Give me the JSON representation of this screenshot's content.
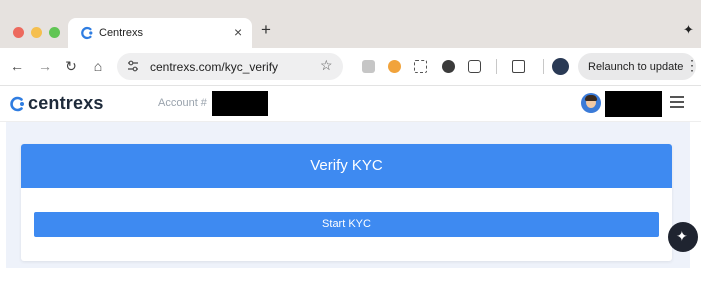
{
  "browser": {
    "tab": {
      "title": "Centrexs",
      "close_icon": "close-icon"
    },
    "new_tab_label": "+",
    "address": {
      "url": "centrexs.com/kyc_verify"
    },
    "relaunch_label": "Relaunch to update",
    "icons": [
      "back-icon",
      "forward-icon",
      "reload-icon",
      "home-icon",
      "site-settings-icon",
      "star-icon",
      "extension-icon",
      "puzzle-icon",
      "tab-search-icon",
      "profile-icon",
      "menu-dots-icon",
      "sparkle-icon"
    ]
  },
  "site": {
    "brand_name": "centrexs",
    "account_label": "Account #",
    "user": {
      "avatar": "user-avatar"
    }
  },
  "kyc": {
    "title": "Verify KYC",
    "start_button": "Start KYC"
  },
  "colors": {
    "accent": "#3e8af1",
    "brand_text": "#1e2a3a",
    "page_bg": "#eef2fa"
  }
}
